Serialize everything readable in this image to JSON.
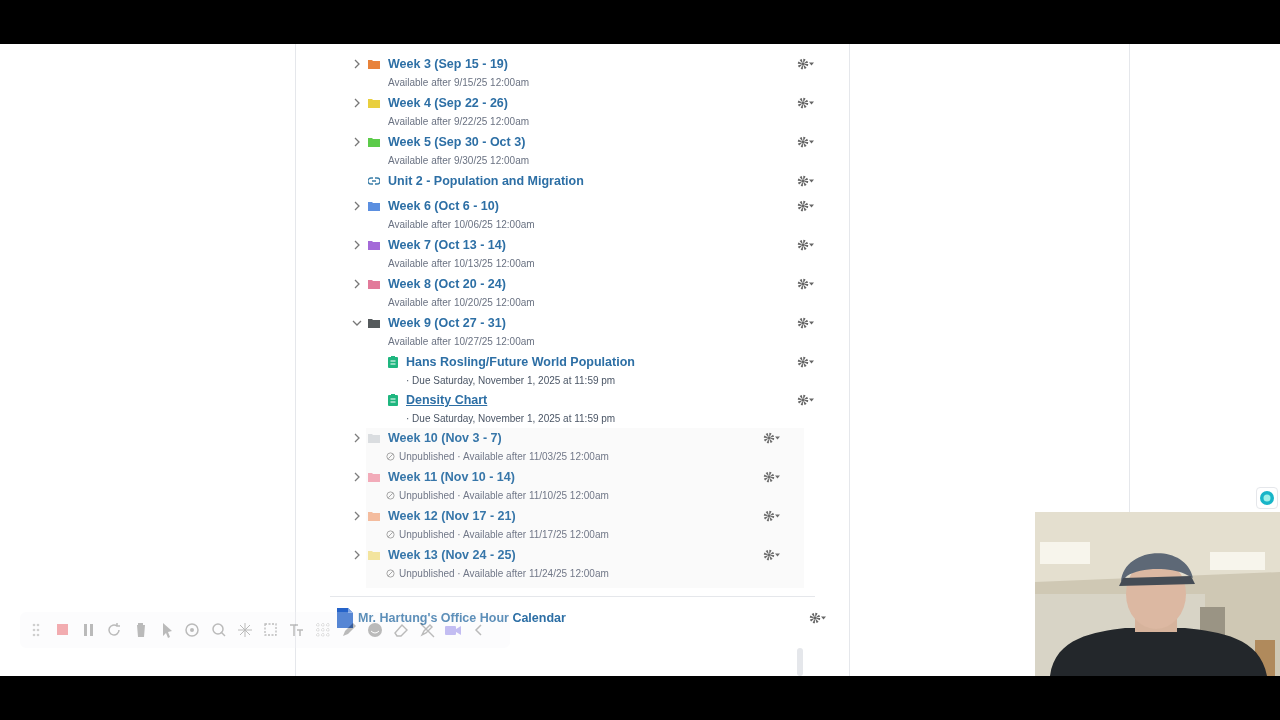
{
  "modules": [
    {
      "kind": "folder",
      "title": "Week 3 (Sep 15 - 19)",
      "color": "#e8823a",
      "expanded": false,
      "published": true,
      "subtitle": "Available after 9/15/25 12:00am"
    },
    {
      "kind": "folder",
      "title": "Week 4 (Sep 22 - 26)",
      "color": "#e9cf3e",
      "expanded": false,
      "published": true,
      "subtitle": "Available after 9/22/25 12:00am"
    },
    {
      "kind": "folder",
      "title": "Week 5 (Sep 30 - Oct 3)",
      "color": "#5ccb4a",
      "expanded": false,
      "published": true,
      "subtitle": "Available after 9/30/25 12:00am"
    },
    {
      "kind": "link",
      "title": "Unit 2 - Population and Migration",
      "published": true
    },
    {
      "kind": "folder",
      "title": "Week 6 (Oct 6 - 10)",
      "color": "#5b8fe0",
      "expanded": false,
      "published": true,
      "subtitle": "Available after 10/06/25 12:00am"
    },
    {
      "kind": "folder",
      "title": "Week 7 (Oct 13 - 14)",
      "color": "#a46ad8",
      "expanded": false,
      "published": true,
      "subtitle": "Available after 10/13/25 12:00am"
    },
    {
      "kind": "folder",
      "title": "Week 8 (Oct 20 - 24)",
      "color": "#e27a9a",
      "expanded": false,
      "published": true,
      "subtitle": "Available after 10/20/25 12:00am"
    },
    {
      "kind": "folder",
      "title": "Week 9 (Oct 27 - 31)",
      "color": "#555a5c",
      "expanded": true,
      "published": true,
      "subtitle": "Available after 10/27/25 12:00am",
      "children": [
        {
          "title": "Hans Rosling/Future World Population",
          "due": "· Due Saturday, November 1, 2025 at 11:59 pm",
          "hovered": false
        },
        {
          "title": "Density Chart",
          "due": "· Due Saturday, November 1, 2025 at 11:59 pm",
          "hovered": true
        }
      ]
    },
    {
      "kind": "folder",
      "title": "Week 10 (Nov 3 - 7)",
      "color": "#d9dcdf",
      "expanded": false,
      "published": false,
      "subtitle": "Unpublished · Available after 11/03/25 12:00am"
    },
    {
      "kind": "folder",
      "title": "Week 11 (Nov 10 - 14)",
      "color": "#f2a7b6",
      "expanded": false,
      "published": false,
      "subtitle": "Unpublished · Available after 11/10/25 12:00am"
    },
    {
      "kind": "folder",
      "title": "Week 12 (Nov 17 - 21)",
      "color": "#f4b99a",
      "expanded": false,
      "published": false,
      "subtitle": "Unpublished · Available after 11/17/25 12:00am"
    },
    {
      "kind": "folder",
      "title": "Week 13 (Nov 24 - 25)",
      "color": "#f3e39a",
      "expanded": false,
      "published": false,
      "subtitle": "Unpublished · Available after 11/24/25 12:00am"
    }
  ],
  "calendar": {
    "title": "Mr. Hartung's Office Hour Calendar"
  }
}
